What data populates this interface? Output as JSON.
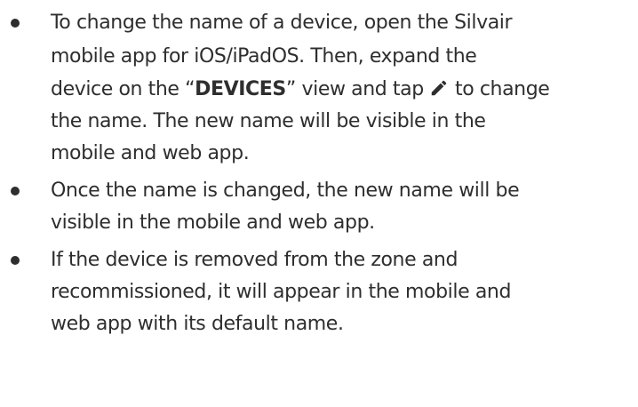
{
  "bullets": [
    {
      "lines": [
        "To change the name of a device, open the Silvair",
        "mobile app for iOS/iPadOS. Then, expand the"
      ],
      "inline_line": {
        "before": "device on the “",
        "bold": "DEVICES",
        "middle": "” view and tap ",
        "icon": "pencil-icon",
        "after": " to change"
      },
      "tail_lines": [
        "the name. The new name will be visible in the",
        "mobile and web app."
      ]
    },
    {
      "lines": [
        "Once the name is changed, the new name will be",
        "visible in the mobile and web app."
      ]
    },
    {
      "lines": [
        "If the device is removed from the zone and",
        "recommissioned, it will appear in the mobile and",
        "web app with its default name."
      ]
    }
  ],
  "colors": {
    "text": "#2e2e2e",
    "background": "#ffffff"
  }
}
